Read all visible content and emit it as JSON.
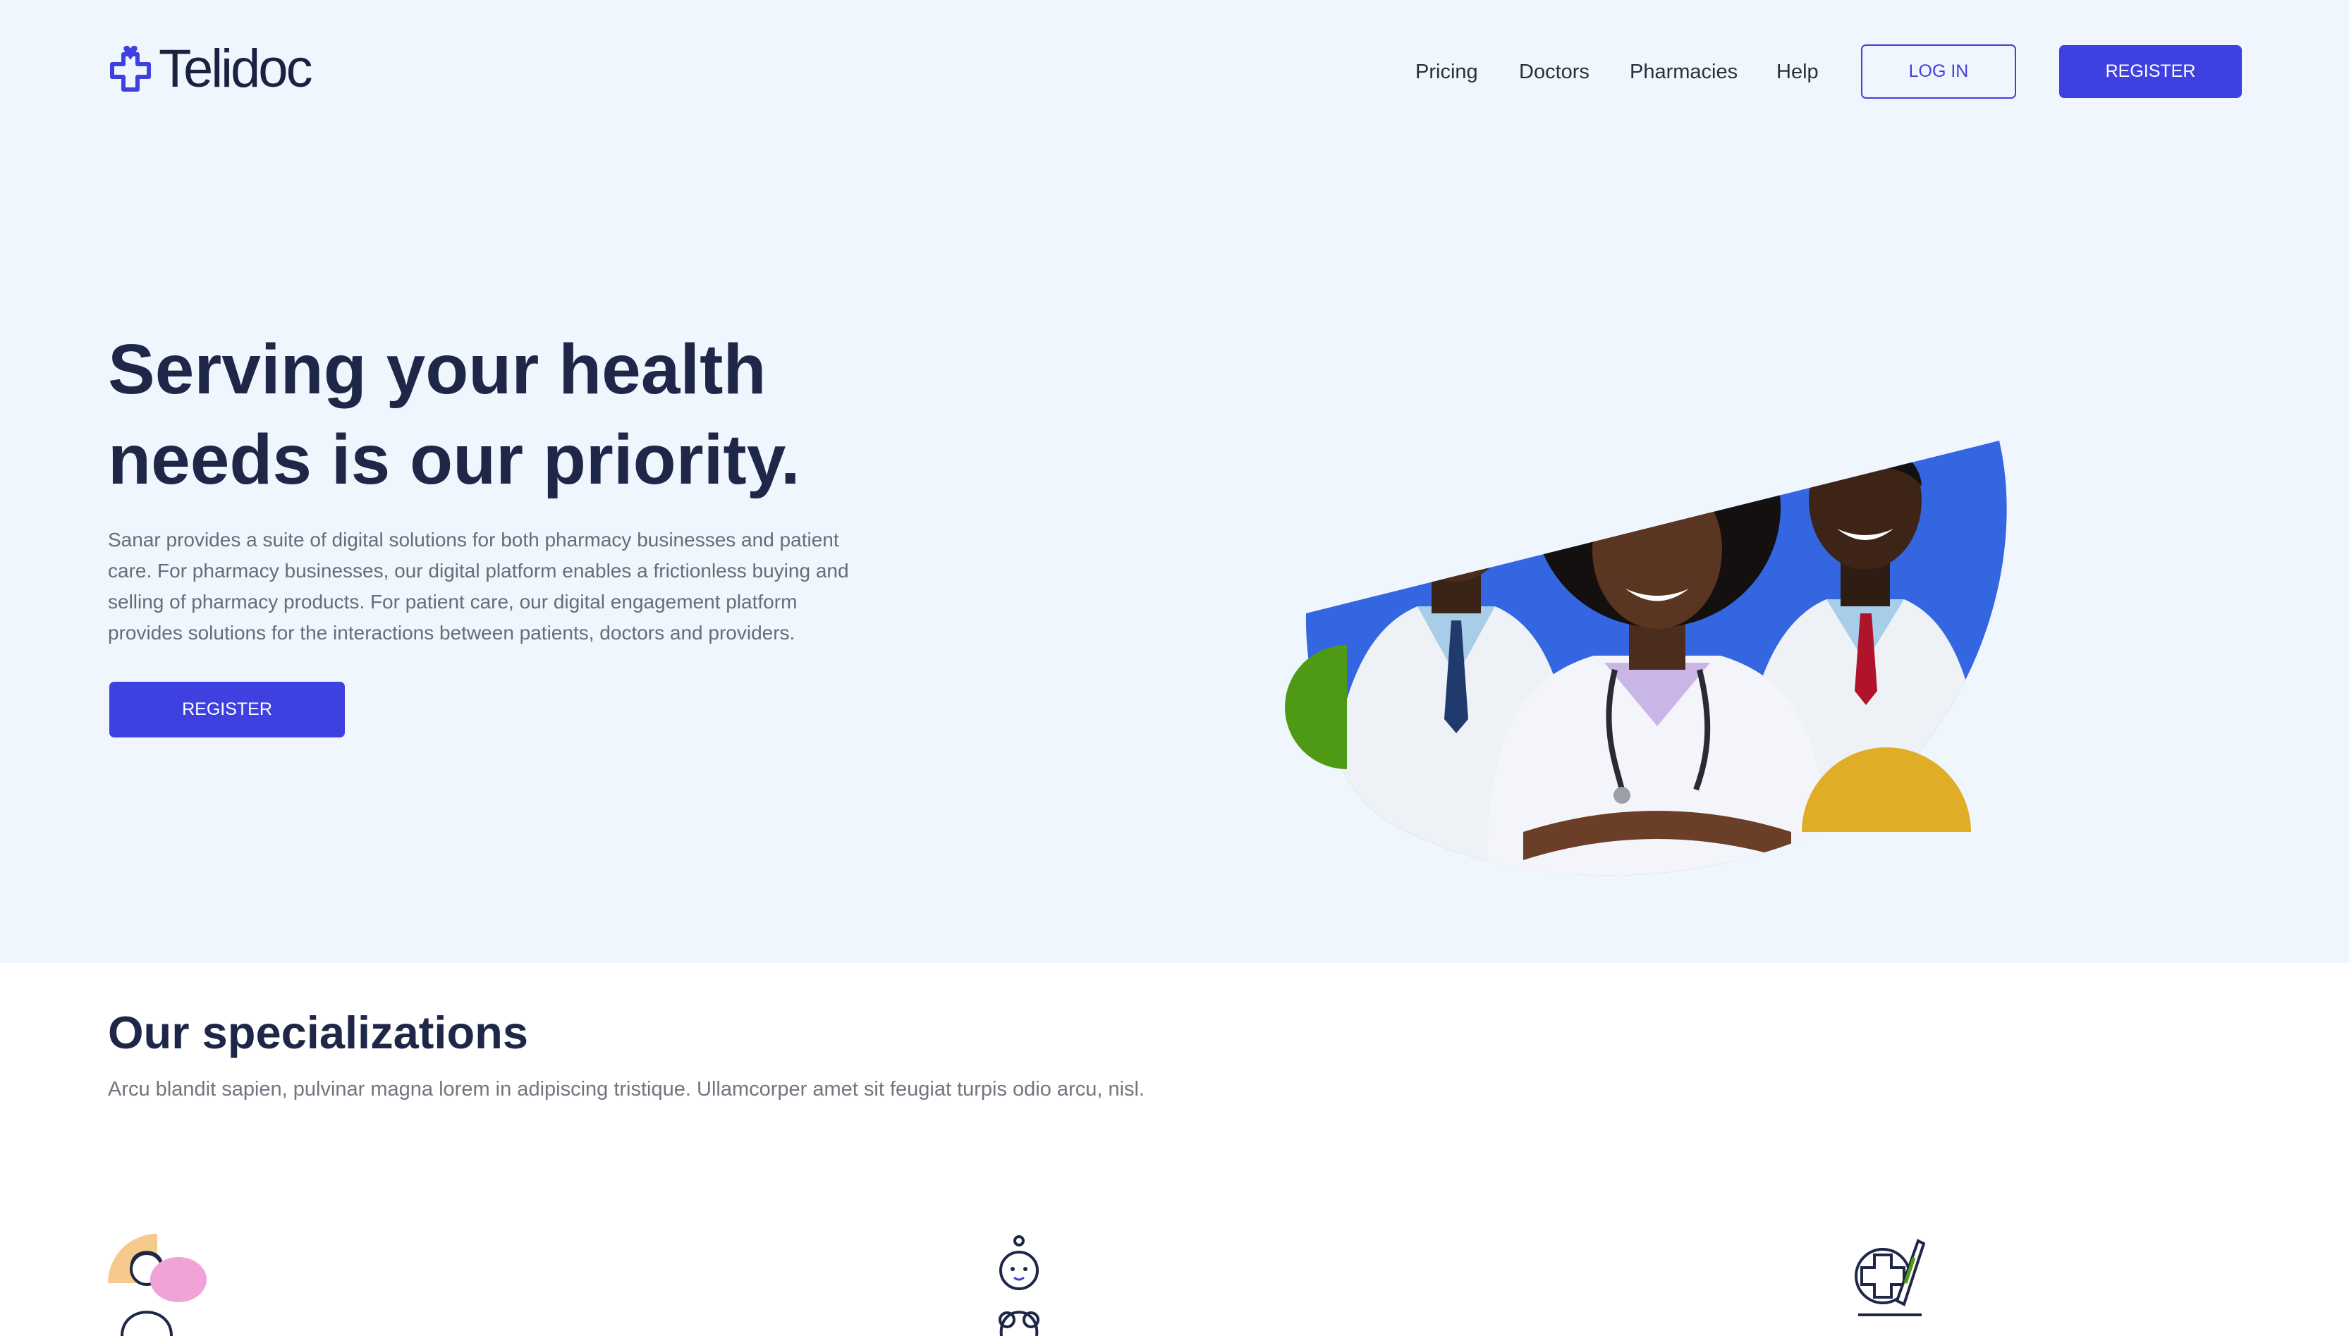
{
  "brand": {
    "name": "Telidoc",
    "accent": "#3f40e0",
    "hero_bg": "#f0f6fd"
  },
  "nav": {
    "items": [
      "Pricing",
      "Doctors",
      "Pharmacies",
      "Help"
    ],
    "login_label": "LOG IN",
    "register_label": "REGISTER"
  },
  "hero": {
    "title_line1": "Serving your health",
    "title_line2": "needs is our priority.",
    "description": "Sanar provides a suite of digital solutions for both pharmacy businesses and patient care. For pharmacy businesses, our digital platform enables a frictionless buying and selling of pharmacy products. For patient care, our digital engagement platform provides solutions for the interactions between patients, doctors and providers.",
    "cta_label": "REGISTER",
    "image": "three-doctors-in-white-coats-smiling",
    "shape_colors": {
      "blue": "#3366e0",
      "green": "#4f9a14",
      "yellow": "#e0ad27"
    }
  },
  "specializations": {
    "title": "Our specializations",
    "subtitle": "Arcu blandit sapien, pulvinar magna lorem in adipiscing tristique. Ullamcorper amet sit feugiat turpis odio arcu, nisl.",
    "icons": [
      "doctor-consultation-icon",
      "baby-pediatrics-icon",
      "medical-record-pen-icon"
    ]
  }
}
